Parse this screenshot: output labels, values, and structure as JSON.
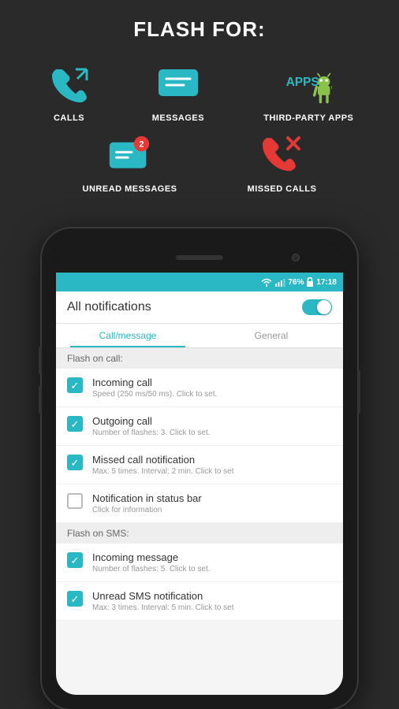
{
  "header": {
    "title": "FLASH FOR:"
  },
  "features": [
    {
      "id": "calls",
      "label": "CALLS",
      "icon_type": "phone-outgoing"
    },
    {
      "id": "messages",
      "label": "MESSAGES",
      "icon_type": "message"
    },
    {
      "id": "third-party-apps",
      "label": "THIRD-PARTY APPS",
      "icon_type": "apps-android"
    }
  ],
  "features2": [
    {
      "id": "unread-messages",
      "label": "UNREAD MESSAGES",
      "icon_type": "message-badge"
    },
    {
      "id": "missed-calls",
      "label": "MISSED CALLS",
      "icon_type": "phone-missed"
    }
  ],
  "phone": {
    "status_bar": {
      "battery": "76%",
      "time": "17:18"
    },
    "app_title": "All notifications",
    "tabs": [
      {
        "label": "Call/message",
        "active": true
      },
      {
        "label": "General",
        "active": false
      }
    ],
    "sections": [
      {
        "header": "Flash on call:",
        "items": [
          {
            "checked": true,
            "title": "Incoming call",
            "subtitle": "Speed (250 ms/50 ms). Click to set."
          },
          {
            "checked": true,
            "title": "Outgoing call",
            "subtitle": "Number of flashes: 3. Click to set."
          },
          {
            "checked": true,
            "title": "Missed call notification",
            "subtitle": "Max: 5 times. Interval: 2 min. Click to set"
          },
          {
            "checked": false,
            "title": "Notification in status bar",
            "subtitle": "Click for information"
          }
        ]
      },
      {
        "header": "Flash on SMS:",
        "items": [
          {
            "checked": true,
            "title": "Incoming message",
            "subtitle": "Number of flashes: 5. Click to set."
          },
          {
            "checked": true,
            "title": "Unread SMS notification",
            "subtitle": "Max: 3 times. Interval: 5 min. Click to set"
          }
        ]
      }
    ]
  }
}
